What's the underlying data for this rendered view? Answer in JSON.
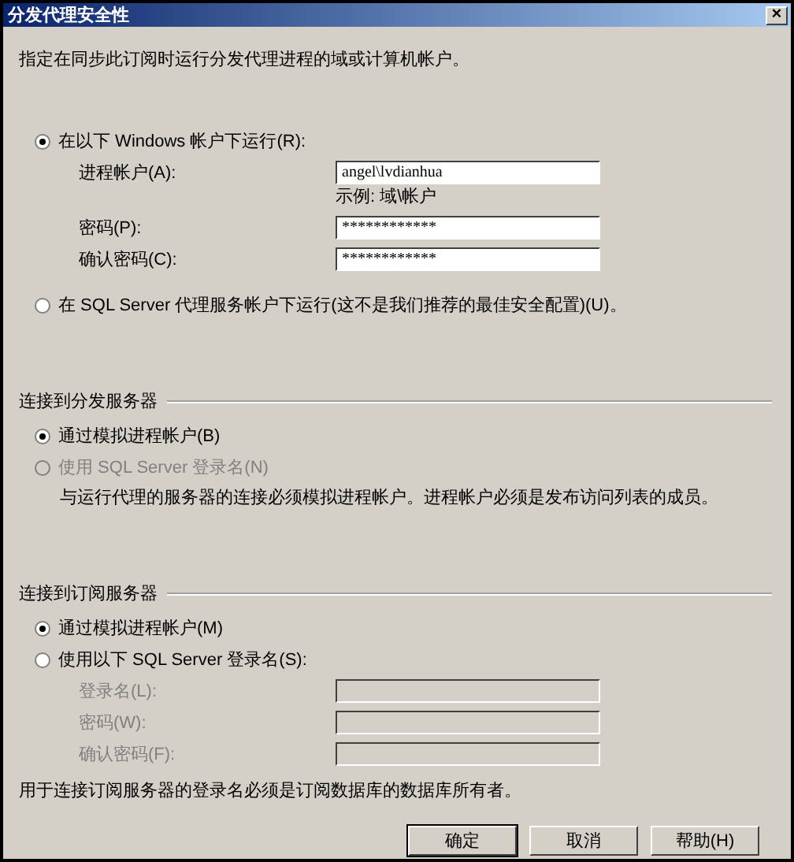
{
  "window": {
    "title": "分发代理安全性",
    "close": "×"
  },
  "description": "指定在同步此订阅时运行分发代理进程的域或计算机帐户。",
  "rows": [
    {
      "kind": "radio",
      "label": "在以下 Windows 帐户下运行(R):",
      "selected": true,
      "disabled": false
    },
    {
      "kind": "field",
      "label": "进程帐户(A):",
      "value": "angel\\lvdianhua",
      "disabled": false
    },
    {
      "kind": "hint",
      "text": "示例: 域\\帐户"
    },
    {
      "kind": "field",
      "label": "密码(P):",
      "value": "************",
      "disabled": false
    },
    {
      "kind": "field",
      "label": "确认密码(C):",
      "value": "************",
      "disabled": false
    },
    {
      "kind": "radio",
      "label": "在 SQL Server 代理服务帐户下运行(这不是我们推荐的最佳安全配置)(U)。",
      "selected": false,
      "disabled": false
    },
    {
      "kind": "heading",
      "text": "连接到分发服务器"
    },
    {
      "kind": "radio",
      "label": "通过模拟进程帐户(B)",
      "selected": true,
      "disabled": false
    },
    {
      "kind": "radio",
      "label": "使用 SQL Server 登录名(N)",
      "selected": false,
      "disabled": true
    },
    {
      "kind": "note",
      "text": "与运行代理的服务器的连接必须模拟进程帐户。进程帐户必须是发布访问列表的成员。",
      "indent": true
    },
    {
      "kind": "heading",
      "text": "连接到订阅服务器"
    },
    {
      "kind": "radio",
      "label": "通过模拟进程帐户(M)",
      "selected": true,
      "disabled": false
    },
    {
      "kind": "radio",
      "label": "使用以下 SQL Server 登录名(S):",
      "selected": false,
      "disabled": false
    },
    {
      "kind": "field",
      "label": "登录名(L):",
      "value": "",
      "disabled": true
    },
    {
      "kind": "field",
      "label": "密码(W):",
      "value": "",
      "disabled": true
    },
    {
      "kind": "field",
      "label": "确认密码(F):",
      "value": "",
      "disabled": true
    },
    {
      "kind": "note",
      "text": "用于连接订阅服务器的登录名必须是订阅数据库的数据库所有者。",
      "indent": false
    }
  ],
  "buttons": [
    {
      "label": "确定",
      "default": true
    },
    {
      "label": "取消",
      "default": false
    },
    {
      "label": "帮助(H)",
      "default": false
    }
  ]
}
